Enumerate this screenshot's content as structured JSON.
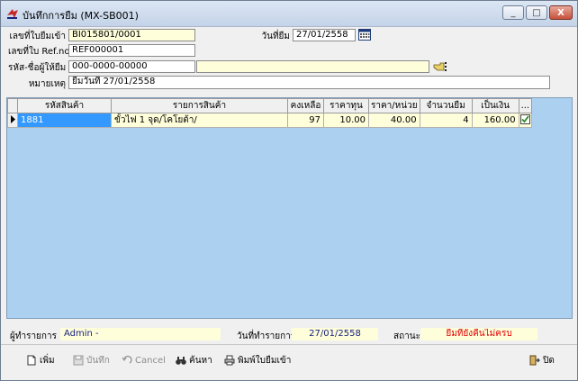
{
  "window": {
    "title": "บันทึกการยืม (MX-SB001)",
    "min_label": "_",
    "max_label": "□",
    "close_label": "X"
  },
  "form": {
    "doc_no_label": "เลขที่ใบยืมเข้า",
    "doc_no_value": "BI015801/0001",
    "ref_label": "เลขที่ใบ Ref.no",
    "ref_value": "REF000001",
    "lender_label": "รหัส-ชื่อผู้ให้ยืม",
    "lender_code": "000-0000-00000",
    "lender_name": "",
    "note_label": "หมายเหตุ",
    "note_value": "ยืมวันที่ 27/01/2558",
    "date_label": "วันที่ยืม",
    "date_value": "27/01/2558"
  },
  "grid": {
    "columns": [
      "รหัสสินค้า",
      "รายการสินค้า",
      "คงเหลือ",
      "ราคาทุน",
      "ราคา/หน่วย",
      "จำนวนยืม",
      "เป็นเงิน",
      "..."
    ],
    "rows": [
      {
        "code": "1881",
        "name": "ขั้วไฟ 1 จุด/โคโยต้า/",
        "stock": "97",
        "cost": "10.00",
        "unit_price": "40.00",
        "qty": "4",
        "amount": "160.00"
      }
    ]
  },
  "status": {
    "user_label": "ผู้ทำรายการ",
    "user_value": "Admin -",
    "txdate_label": "วันที่ทำรายการ",
    "txdate_value": "27/01/2558",
    "state_label": "สถานะ",
    "state_value": "ยืมที่ยังคืนไม่ครบ",
    "state_color": "#e00000"
  },
  "toolbar": {
    "add": "เพิ่ม",
    "save": "บันทึก",
    "cancel": "Cancel",
    "search": "ค้นหา",
    "print": "พิมพ์ใบยืมเข้า",
    "close": "ปิด"
  }
}
